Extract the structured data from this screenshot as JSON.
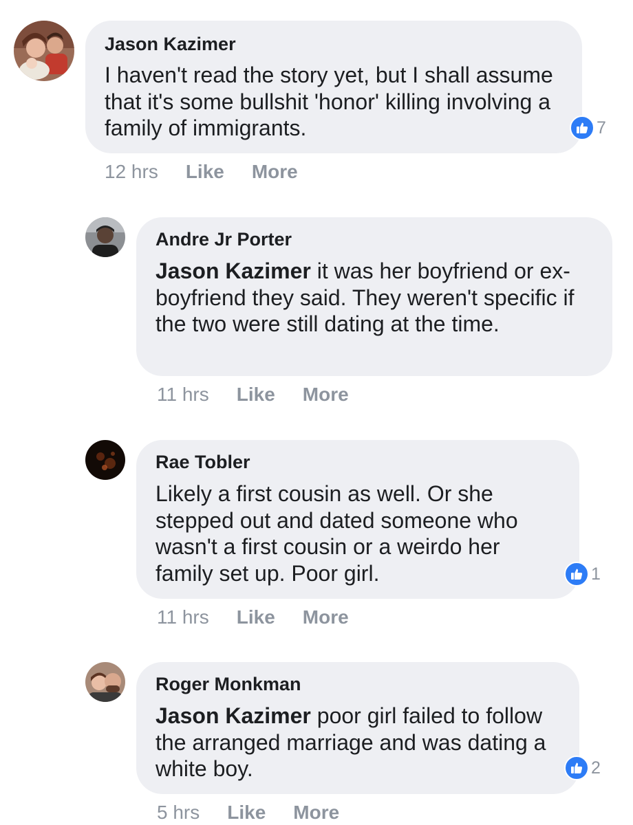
{
  "comments": [
    {
      "author": "Jason Kazimer",
      "mention": "",
      "text": "I haven't read the story yet, but I shall assume that it's some bullshit 'honor' killing involving a family of immigrants.",
      "reactions": "7",
      "time": "12 hrs",
      "like_label": "Like",
      "more_label": "More",
      "avatar_icon": "user-photo-icon"
    },
    {
      "author": "Andre Jr Porter",
      "mention": "Jason Kazimer",
      "text": "it was her boyfriend or ex-boyfriend they said. They weren't specific if the two were still dating at the time.",
      "reactions": "",
      "time": "11 hrs",
      "like_label": "Like",
      "more_label": "More",
      "avatar_icon": "user-photo-icon"
    },
    {
      "author": "Rae Tobler",
      "mention": "",
      "text": "Likely a first cousin as well. Or she stepped out and dated someone who wasn't a first cousin or a weirdo her family set up. Poor girl.",
      "reactions": "1",
      "time": "11 hrs",
      "like_label": "Like",
      "more_label": "More",
      "avatar_icon": "user-photo-icon"
    },
    {
      "author": "Roger Monkman",
      "mention": "Jason Kazimer",
      "text": "poor girl failed to follow the arranged marriage and was dating a white boy.",
      "reactions": "2",
      "time": "5 hrs",
      "like_label": "Like",
      "more_label": "More",
      "avatar_icon": "user-photo-icon"
    }
  ],
  "colors": {
    "bubble": "#eeeff3",
    "like_blue": "#2d7cf6",
    "meta_gray": "#8d949e",
    "text": "#1c1e21"
  }
}
